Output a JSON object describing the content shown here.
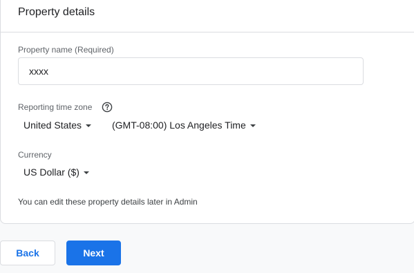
{
  "card": {
    "title": "Property details"
  },
  "property_name": {
    "label": "Property name (Required)",
    "value": "xxxx"
  },
  "time_zone": {
    "label": "Reporting time zone",
    "help_icon": "help-circle-icon",
    "country": "United States",
    "zone": "(GMT-08:00) Los Angeles Time"
  },
  "currency": {
    "label": "Currency",
    "value": "US Dollar ($)"
  },
  "note": "You can edit these property details later in Admin",
  "actions": {
    "back_label": "Back",
    "next_label": "Next"
  },
  "colors": {
    "primary": "#1a73e8",
    "border": "#dadce0",
    "text": "#202124",
    "secondary_text": "#5f6368"
  }
}
